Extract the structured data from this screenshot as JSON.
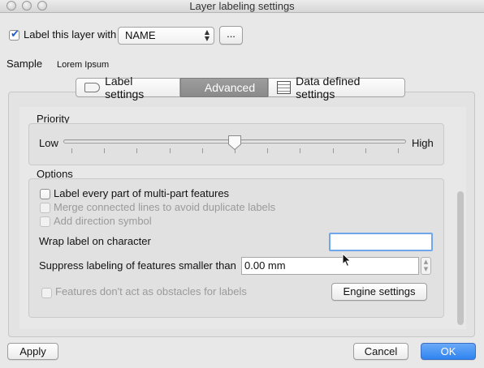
{
  "window": {
    "title": "Layer labeling settings"
  },
  "header": {
    "label_layer_with": "Label this layer with",
    "field_value": "NAME",
    "expression_button": "...",
    "sample_label": "Sample",
    "sample_text": "Lorem Ipsum"
  },
  "tabs": [
    {
      "label": "Label settings"
    },
    {
      "label": "Advanced"
    },
    {
      "label": "Data defined settings"
    }
  ],
  "priority": {
    "title": "Priority",
    "low": "Low",
    "high": "High",
    "value_fraction": 0.5
  },
  "options": {
    "title": "Options",
    "label_every_part": "Label every part of multi-part features",
    "merge_lines": "Merge connected lines to avoid duplicate labels",
    "add_direction": "Add direction symbol",
    "wrap_label": "Wrap label on character",
    "wrap_value": "",
    "suppress_label": "Suppress labeling of features smaller than",
    "suppress_value": "0.00 mm",
    "obstacles": "Features don't act as obstacles for labels",
    "engine_button": "Engine settings"
  },
  "footer": {
    "apply": "Apply",
    "cancel": "Cancel",
    "ok": "OK"
  },
  "colors": {
    "ok_button": "#2f84f0",
    "checkbox_tick": "#1a5fd0"
  }
}
